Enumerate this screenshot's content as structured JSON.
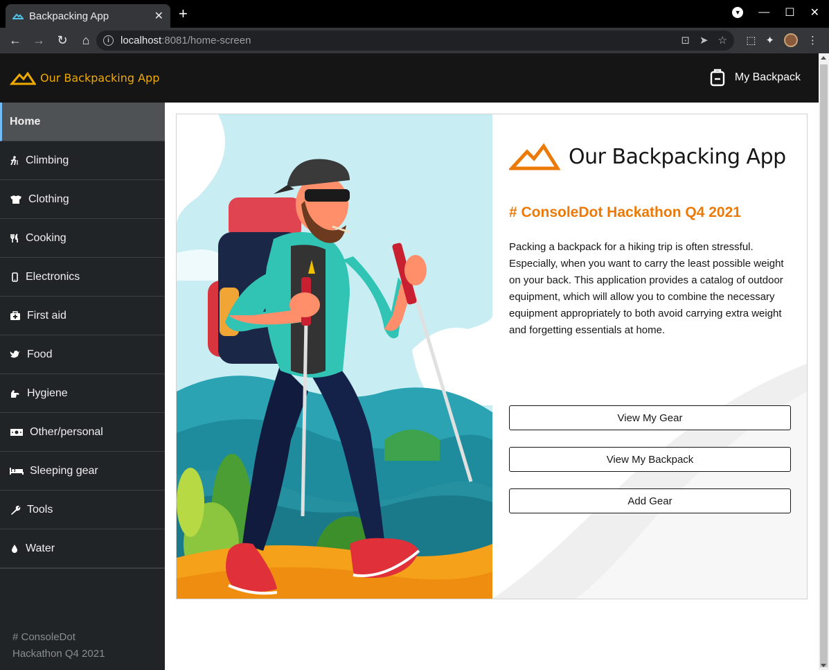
{
  "browser": {
    "tab_title": "Backpacking App",
    "tab_close": "✕",
    "new_tab": "+",
    "url_host": "localhost",
    "url_rest": ":8081/home-screen"
  },
  "header": {
    "brand": "Our Backpacking App",
    "backpack_link": "My Backpack"
  },
  "sidebar": {
    "items": [
      {
        "label": "Home",
        "icon": ""
      },
      {
        "label": "Climbing",
        "icon": "hiker-icon"
      },
      {
        "label": "Clothing",
        "icon": "tshirt-icon"
      },
      {
        "label": "Cooking",
        "icon": "utensils-icon"
      },
      {
        "label": "Electronics",
        "icon": "mobile-icon"
      },
      {
        "label": "First aid",
        "icon": "medkit-icon"
      },
      {
        "label": "Food",
        "icon": "bird-icon"
      },
      {
        "label": "Hygiene",
        "icon": "hand-icon"
      },
      {
        "label": "Other/personal",
        "icon": "money-icon"
      },
      {
        "label": "Sleeping gear",
        "icon": "bed-icon"
      },
      {
        "label": "Tools",
        "icon": "wrench-icon"
      },
      {
        "label": "Water",
        "icon": "drop-icon"
      }
    ],
    "footer_line1": "# ConsoleDot",
    "footer_line2": "Hackathon Q4 2021"
  },
  "main": {
    "logo_text": "Our Backpacking App",
    "heading": "# ConsoleDot Hackathon Q4 2021",
    "description": "Packing a backpack for a hiking trip is often stressful. Especially, when you want to carry the least possible weight on your back. This application provides a catalog of outdoor equipment, which will allow you to combine the necessary equipment appropriately to both avoid carrying extra weight and forgetting essentials at home.",
    "buttons": {
      "view_gear": "View My Gear",
      "view_backpack": "View My Backpack",
      "add_gear": "Add Gear"
    }
  },
  "colors": {
    "accent": "#ec7a08",
    "brand": "#f0ab00",
    "sidebar_bg": "#212427",
    "header_bg": "#151515"
  }
}
